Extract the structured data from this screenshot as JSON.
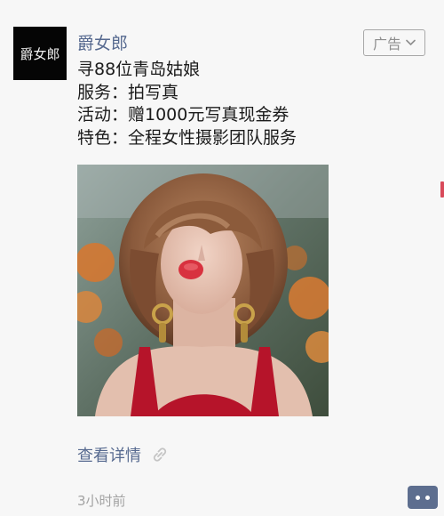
{
  "post": {
    "avatar_text": "爵女郎",
    "account_name": "爵女郎",
    "ad_label": "广告",
    "ad_dropdown_icon": "chevron-down-icon",
    "lines": [
      "寻88位青岛姑娘",
      "服务：拍写真",
      "活动：赠1000元写真现金券",
      "特色：全程女性摄影团队服务"
    ],
    "photo_icon": "portrait-photo",
    "link_label": "查看详情",
    "link_icon": "link-icon",
    "time": "3小时前",
    "comment_icon": "comment-more-icon"
  },
  "colors": {
    "name_link": "#56698f",
    "body_text": "#1b1b1b",
    "muted": "#a3a3a3",
    "comment_button": "#5d6e8f",
    "background": "#f7f7f7"
  }
}
